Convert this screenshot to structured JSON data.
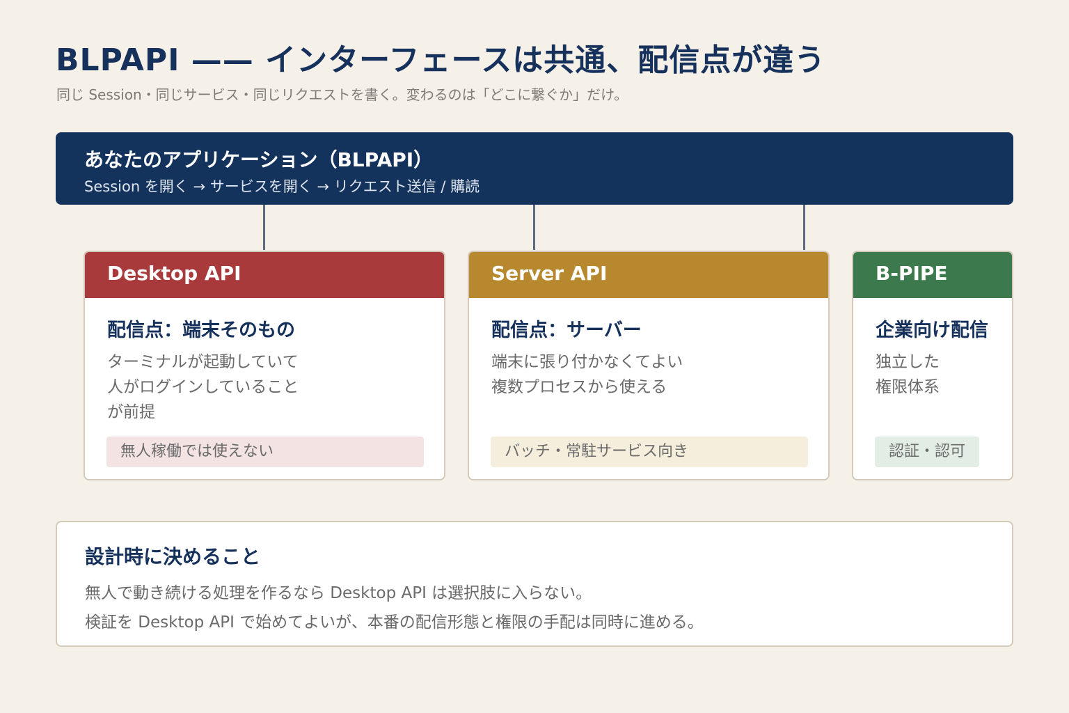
{
  "header": {
    "title": "BLPAPI —— インターフェースは共通、配信点が違う",
    "subtitle": "同じ Session・同じサービス・同じリクエストを書く。変わるのは「どこに繋ぐか」だけ。"
  },
  "app": {
    "title": "あなたのアプリケーション（BLPAPI）",
    "flow": "Session を開く → サービスを開く → リクエスト送信 / 購読"
  },
  "cards": [
    {
      "name": "Desktop API",
      "color": "#a83a3b",
      "subtitle": "配信点：端末そのもの",
      "desc": [
        "ターミナルが起動していて",
        "人がログインしていること",
        "が前提"
      ],
      "tag": "無人稼働では使えない",
      "tag_bg": "#f3e3e3"
    },
    {
      "name": "Server API",
      "color": "#b8882e",
      "subtitle": "配信点：サーバー",
      "desc": [
        "端末に張り付かなくてよい",
        "複数プロセスから使える"
      ],
      "tag": "バッチ・常駐サービス向き",
      "tag_bg": "#f6eedc"
    },
    {
      "name": "B-PIPE",
      "color": "#3c7a4e",
      "subtitle": "企業向け配信",
      "desc": [
        "独立した",
        "権限体系"
      ],
      "tag": "認証・認可",
      "tag_bg": "#e2ede5"
    }
  ],
  "note": {
    "title": "設計時に決めること",
    "lines": [
      "無人で動き続ける処理を作るなら Desktop API は選択肢に入らない。",
      "検証を Desktop API で始めてよいが、本番の配信形態と権限の手配は同時に進める。"
    ]
  }
}
